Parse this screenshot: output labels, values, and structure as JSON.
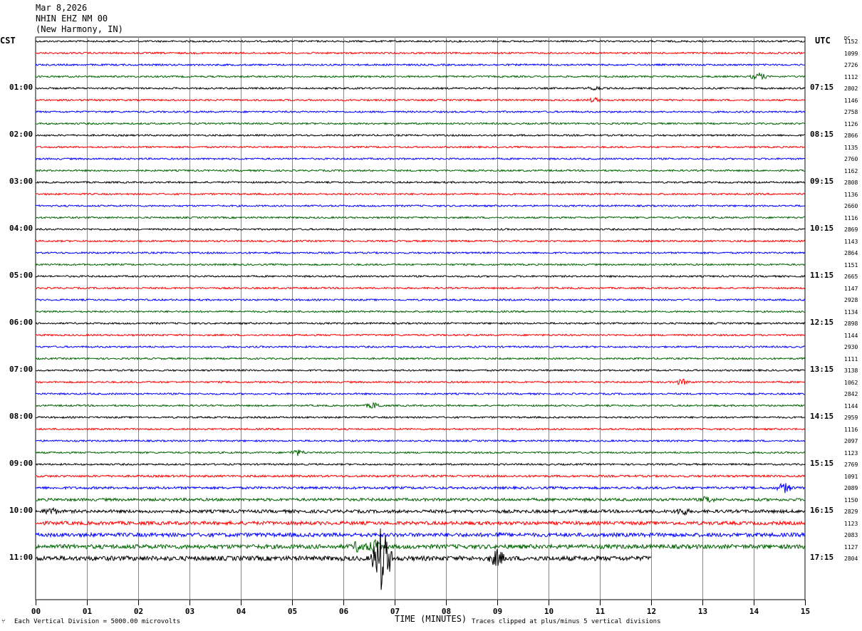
{
  "header": {
    "date": "Mar 8,2026",
    "station": "NHIN EHZ NM 00",
    "location": "(New Harmony, IN)"
  },
  "left_tz": "CST",
  "right_tz": "UTC",
  "dc_header": "DC",
  "footer": {
    "left_note": "Each Vertical Division = 5000.00 microvolts",
    "center_label": "TIME (MINUTES)",
    "right_note": "Traces clipped at plus/minus 5 vertical divisions",
    "corner_mark": "⑂"
  },
  "chart_data": {
    "type": "line",
    "subtype": "helicorder",
    "xlabel": "TIME (MINUTES)",
    "x_ticks": [
      "00",
      "01",
      "02",
      "03",
      "04",
      "05",
      "06",
      "07",
      "08",
      "09",
      "10",
      "11",
      "12",
      "13",
      "14",
      "15"
    ],
    "xlim": [
      0,
      15
    ],
    "minutes_per_line": 15,
    "trace_colors": [
      "#000000",
      "#ff0000",
      "#0000ff",
      "#006400"
    ],
    "left_hour_labels": [
      "01:00",
      "02:00",
      "03:00",
      "04:00",
      "05:00",
      "06:00",
      "07:00",
      "08:00",
      "09:00",
      "10:00",
      "11:00"
    ],
    "right_hour_labels": [
      "07:15",
      "08:15",
      "09:15",
      "10:15",
      "11:15",
      "12:15",
      "13:15",
      "14:15",
      "15:15",
      "16:15",
      "17:15"
    ],
    "dc_values": [
      "1152",
      "1099",
      "2726",
      "1112",
      "2802",
      "1146",
      "2758",
      "1126",
      "2866",
      "1135",
      "2760",
      "1162",
      "2808",
      "1136",
      "2660",
      "1116",
      "2869",
      "1143",
      "2864",
      "1151",
      "2665",
      "1147",
      "2928",
      "1134",
      "2898",
      "1144",
      "2930",
      "1111",
      "3138",
      "1062",
      "2842",
      "1144",
      "2959",
      "1116",
      "2097",
      "1123",
      "2769",
      "1091",
      "2089",
      "1150",
      "2829",
      "1123",
      "2083",
      "1127",
      "2804"
    ],
    "last_trace_end_minute": 12,
    "events": [
      {
        "trace": 3,
        "minute": 14.1,
        "amp": 6
      },
      {
        "trace": 4,
        "minute": 10.9,
        "amp": 4
      },
      {
        "trace": 5,
        "minute": 10.9,
        "amp": 4
      },
      {
        "trace": 29,
        "minute": 12.6,
        "amp": 5
      },
      {
        "trace": 31,
        "minute": 6.6,
        "amp": 5
      },
      {
        "trace": 35,
        "minute": 5.1,
        "amp": 5
      },
      {
        "trace": 38,
        "minute": 14.6,
        "amp": 8
      },
      {
        "trace": 39,
        "minute": 13.1,
        "amp": 6
      },
      {
        "trace": 40,
        "minute": 0.3,
        "amp": 7
      },
      {
        "trace": 40,
        "minute": 12.6,
        "amp": 7
      },
      {
        "trace": 42,
        "minute": 9.0,
        "amp": 5
      },
      {
        "trace": 43,
        "minute": 6.3,
        "amp": 10
      },
      {
        "trace": 43,
        "minute": 6.6,
        "amp": 12
      },
      {
        "trace": 44,
        "minute": 6.75,
        "amp": 50
      },
      {
        "trace": 44,
        "minute": 9.0,
        "amp": 14
      }
    ]
  }
}
